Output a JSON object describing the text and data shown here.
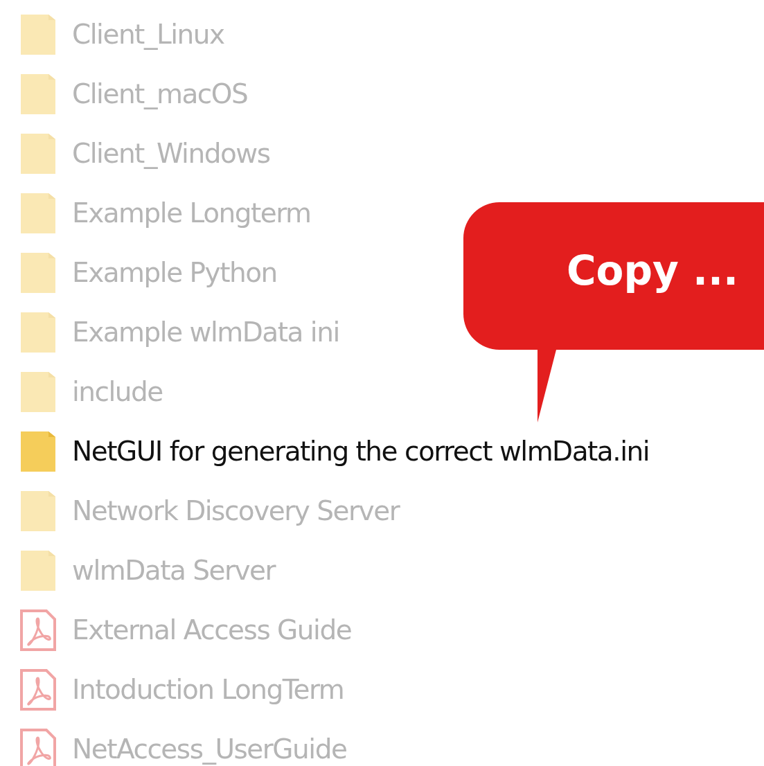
{
  "files": [
    {
      "kind": "folder",
      "name": "Client_Linux",
      "dimmed": true
    },
    {
      "kind": "folder",
      "name": "Client_macOS",
      "dimmed": true
    },
    {
      "kind": "folder",
      "name": "Client_Windows",
      "dimmed": true
    },
    {
      "kind": "folder",
      "name": "Example Longterm",
      "dimmed": true
    },
    {
      "kind": "folder",
      "name": "Example Python",
      "dimmed": true
    },
    {
      "kind": "folder",
      "name": "Example wlmData ini",
      "dimmed": true
    },
    {
      "kind": "folder",
      "name": "include",
      "dimmed": true
    },
    {
      "kind": "folder",
      "name": "NetGUI for generating the correct wlmData.ini",
      "dimmed": false
    },
    {
      "kind": "folder",
      "name": "Network Discovery Server",
      "dimmed": true
    },
    {
      "kind": "folder",
      "name": "wlmData Server",
      "dimmed": true
    },
    {
      "kind": "pdf",
      "name": "External Access Guide",
      "dimmed": true
    },
    {
      "kind": "pdf",
      "name": "Intoduction LongTerm",
      "dimmed": true
    },
    {
      "kind": "pdf",
      "name": "NetAccess_UserGuide",
      "dimmed": true
    }
  ],
  "callout": {
    "text": "Copy ..."
  }
}
